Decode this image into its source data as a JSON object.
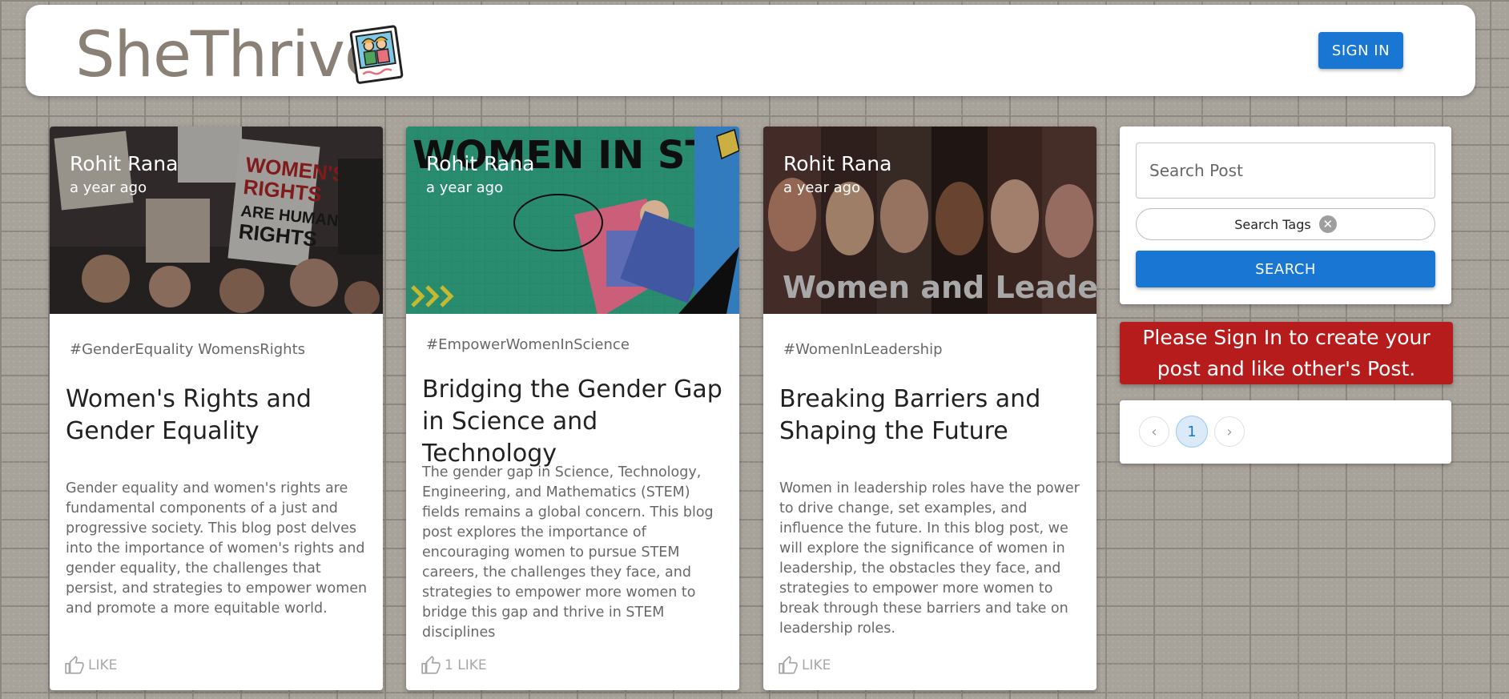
{
  "header": {
    "logo_text": "SheThrive",
    "logo_icon": "photo-frame-icon",
    "signin_label": "SIGN IN"
  },
  "posts": [
    {
      "author": "Rohit Rana",
      "time": "a year ago",
      "tags": "#GenderEquality WomensRights",
      "title": "Women's Rights and Gender Equality",
      "body": "Gender equality and women's rights are fundamental components of a just and progressive society. This blog post delves into the importance of women's rights and gender equality, the challenges that persist, and strategies to empower women and promote a more equitable world.",
      "like_label": "LIKE"
    },
    {
      "author": "Rohit Rana",
      "time": "a year ago",
      "tags": "#EmpowerWomenInScience",
      "title": "Bridging the Gender Gap in Science and Technology",
      "body": "The gender gap in Science, Technology, Engineering, and Mathematics (STEM) fields remains a global concern. This blog post explores the importance of encouraging women to pursue STEM careers, the challenges they face, and strategies to empower more women to bridge this gap and thrive in STEM disciplines",
      "like_label": "1 LIKE",
      "image_text": "WOMEN IN STEM"
    },
    {
      "author": "Rohit Rana",
      "time": "a year ago",
      "tags": "#WomenInLeadership",
      "title": "Breaking Barriers and Shaping the Future",
      "body": "Women in leadership roles have the power to drive change, set examples, and influence the future. In this blog post, we will explore the significance of women in leadership, the obstacles they face, and strategies to empower more women to break through these barriers and take on leadership roles.",
      "like_label": "LIKE",
      "image_text": "Women and Leadershi"
    }
  ],
  "sidebar": {
    "search_placeholder": "Search Post",
    "tags_label": "Search Tags",
    "search_label": "SEARCH",
    "notice": "Please Sign In to create your post and like other's Post.",
    "pagination": {
      "current_page": "1"
    }
  },
  "colors": {
    "primary": "#1976d2",
    "notice_bg": "#b71c1c",
    "logo_text": "#8a8076"
  }
}
